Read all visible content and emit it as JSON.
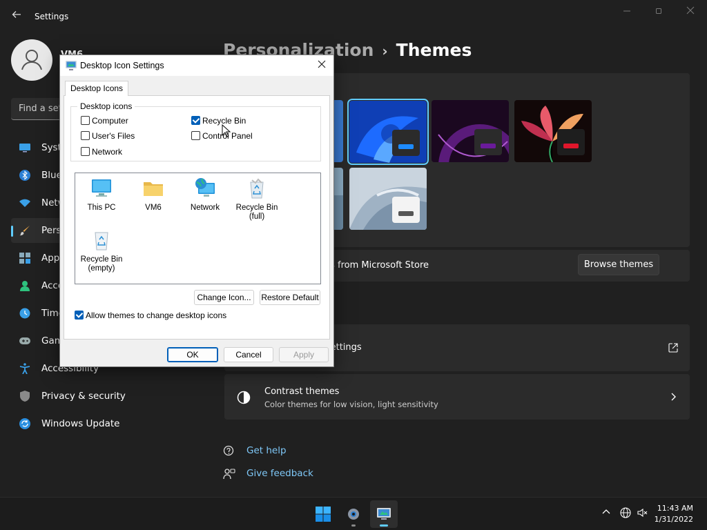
{
  "settings": {
    "app_title": "Settings",
    "user_name": "VM6",
    "search_placeholder": "Find a setting",
    "nav": [
      {
        "label": "System",
        "icon": "monitor-icon"
      },
      {
        "label": "Bluetooth & devices",
        "icon": "bluetooth-icon"
      },
      {
        "label": "Network & internet",
        "icon": "wifi-icon"
      },
      {
        "label": "Personalization",
        "icon": "brush-icon",
        "active": true
      },
      {
        "label": "Apps",
        "icon": "apps-icon"
      },
      {
        "label": "Accounts",
        "icon": "person-icon"
      },
      {
        "label": "Time & language",
        "icon": "clock-globe-icon"
      },
      {
        "label": "Gaming",
        "icon": "gamepad-icon"
      },
      {
        "label": "Accessibility",
        "icon": "accessibility-icon"
      },
      {
        "label": "Privacy & security",
        "icon": "shield-icon"
      },
      {
        "label": "Windows Update",
        "icon": "update-icon"
      }
    ],
    "breadcrumb": {
      "parent": "Personalization",
      "separator": "›",
      "current": "Themes"
    },
    "store_row_text": "Get more themes from Microsoft Store",
    "browse_button": "Browse themes",
    "desktop_icon_row_text": "Desktop icon settings",
    "contrast": {
      "title": "Contrast themes",
      "subtitle": "Color themes for low vision, light sensitivity"
    },
    "links": {
      "help": "Get help",
      "feedback": "Give feedback"
    }
  },
  "dialog": {
    "title": "Desktop Icon Settings",
    "tab": "Desktop Icons",
    "group_label": "Desktop icons",
    "checkboxes": [
      {
        "label": "Computer",
        "checked": false
      },
      {
        "label": "Recycle Bin",
        "checked": true
      },
      {
        "label": "User's Files",
        "checked": false
      },
      {
        "label": "Control Panel",
        "checked": false
      },
      {
        "label": "Network",
        "checked": false
      }
    ],
    "icons": [
      {
        "line1": "This PC",
        "line2": ""
      },
      {
        "line1": "VM6",
        "line2": ""
      },
      {
        "line1": "Network",
        "line2": ""
      },
      {
        "line1": "Recycle Bin",
        "line2": "(full)"
      },
      {
        "line1": "Recycle Bin",
        "line2": "(empty)"
      }
    ],
    "change_icon_button": "Change Icon...",
    "restore_default_button": "Restore Default",
    "allow_themes_label": "Allow themes to change desktop icons",
    "allow_themes_checked": true,
    "ok_button": "OK",
    "cancel_button": "Cancel",
    "apply_button": "Apply"
  },
  "taskbar": {
    "time": "11:43 AM",
    "date": "1/31/2022"
  },
  "colors": {
    "accent": "#60cdff",
    "background": "#202020",
    "card": "#2b2b2b",
    "windows_blue": "#005fb8"
  }
}
